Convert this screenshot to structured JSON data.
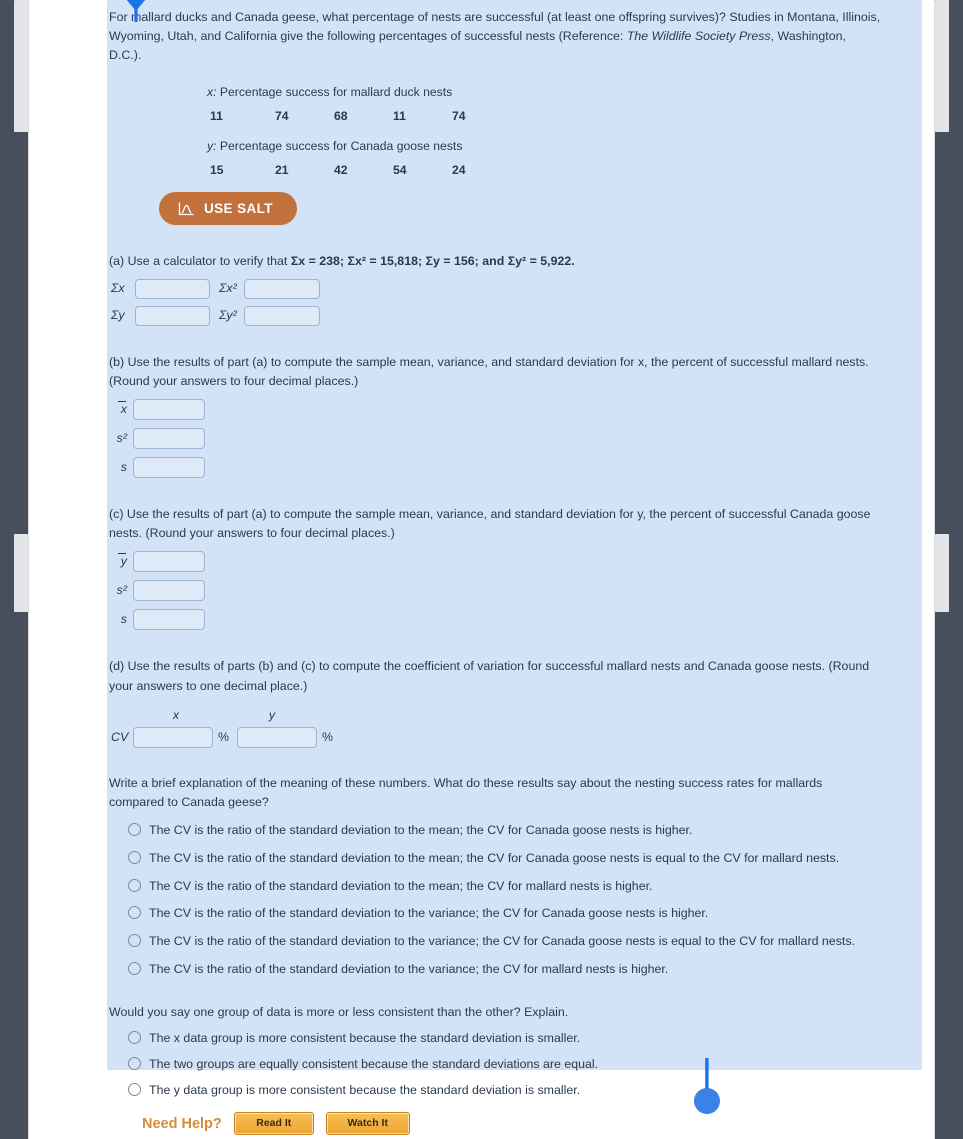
{
  "intro": {
    "text_a": "For mallard ducks and Canada geese, what percentage of nests are successful (at least one offspring survives)? Studies in Montana, Illinois, Wyoming, Utah, and California give the following percentages of successful nests (Reference: ",
    "source_italic": "The Wildlife Society Press",
    "text_b": ", Washington, D.C.)."
  },
  "data": {
    "x_label_var": "x:",
    "x_label": " Percentage success for mallard duck nests",
    "x_values": [
      "11",
      "74",
      "68",
      "11",
      "74"
    ],
    "y_label_var": "y:",
    "y_label": " Percentage success for Canada goose nests",
    "y_values": [
      "15",
      "21",
      "42",
      "54",
      "24"
    ]
  },
  "salt": {
    "label": "USE SALT",
    "icon": "salt-chart-icon",
    "color": "#c2703c"
  },
  "part_a": {
    "prompt_pre": "(a) Use a calculator to verify that ",
    "prompt_bold": "Σx = 238; Σx² = 15,818; Σy = 156; and Σy² = 5,922.",
    "fields": [
      {
        "label": "Σx",
        "value": ""
      },
      {
        "label": "Σx²",
        "value": ""
      },
      {
        "label": "Σy",
        "value": ""
      },
      {
        "label": "Σy²",
        "value": ""
      }
    ]
  },
  "part_b": {
    "prompt": "(b) Use the results of part (a) to compute the sample mean, variance, and standard deviation for x, the percent of successful mallard nests. (Round your answers to four decimal places.)",
    "fields": [
      {
        "label": "x",
        "overbar": true,
        "value": ""
      },
      {
        "label": "s²",
        "overbar": false,
        "value": ""
      },
      {
        "label": "s",
        "overbar": false,
        "value": ""
      }
    ]
  },
  "part_c": {
    "prompt": "(c) Use the results of part (a) to compute the sample mean, variance, and standard deviation for y, the percent of successful Canada goose nests. (Round your answers to four decimal places.)",
    "fields": [
      {
        "label": "y",
        "overbar": true,
        "value": ""
      },
      {
        "label": "s²",
        "overbar": false,
        "value": ""
      },
      {
        "label": "s",
        "overbar": false,
        "value": ""
      }
    ]
  },
  "part_d": {
    "prompt": "(d) Use the results of parts (b) and (c) to compute the coefficient of variation for successful mallard nests and Canada goose nests. (Round your answers to one decimal place.)",
    "col_x": "x",
    "col_y": "y",
    "row_label": "CV",
    "percent_symbol": "%",
    "value_x": "",
    "value_y": ""
  },
  "question_1": {
    "prompt": "Write a brief explanation of the meaning of these numbers. What do these results say about the nesting success rates for mallards compared to Canada geese?",
    "options": [
      "The CV is the ratio of the standard deviation to the mean; the CV for Canada goose nests is higher.",
      "The CV is the ratio of the standard deviation to the mean; the CV for Canada goose nests is equal to the CV for mallard nests.",
      "The CV is the ratio of the standard deviation to the mean; the CV for mallard nests is higher.",
      "The CV is the ratio of the standard deviation to the variance; the CV for Canada goose nests is higher.",
      "The CV is the ratio of the standard deviation to the variance; the CV for Canada goose nests is equal to the CV for mallard nests.",
      "The CV is the ratio of the standard deviation to the variance; the CV for mallard nests is higher."
    ]
  },
  "question_2": {
    "prompt": "Would you say one group of data is more or less consistent than the other? Explain.",
    "options": [
      "The x data group is more consistent because the standard deviation is smaller.",
      "The two groups are equally consistent because the standard deviations are equal.",
      "The y data group is more consistent because the standard deviation is smaller."
    ]
  },
  "need_help": {
    "label": "Need Help?",
    "read_button": "Read It",
    "watch_button": "Watch It"
  },
  "colors": {
    "selection_highlight": "#d3e3f7",
    "field_border": "#9fb3cc",
    "salt_orange": "#c2703c",
    "help_orange": "#d78b3a",
    "handle_blue": "#1a73e8"
  }
}
